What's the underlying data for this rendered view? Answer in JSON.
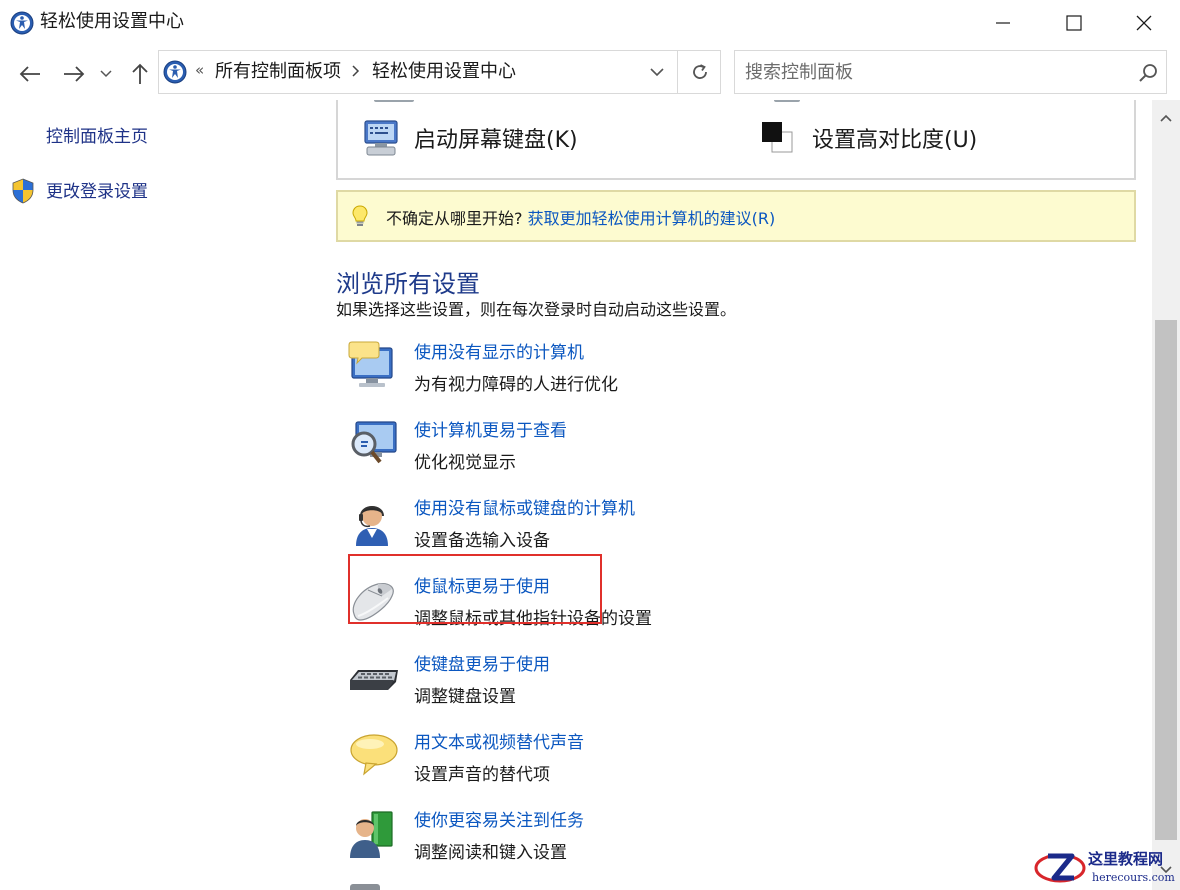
{
  "window": {
    "title": "轻松使用设置中心"
  },
  "address": {
    "overflow": "«",
    "crumbs": [
      "所有控制面板项",
      "轻松使用设置中心"
    ]
  },
  "search": {
    "placeholder": "搜索控制面板"
  },
  "sidebar": {
    "links": [
      "控制面板主页",
      "更改登录设置"
    ]
  },
  "quick_access": {
    "items": [
      "启动屏幕键盘(K)",
      "设置高对比度(U)"
    ]
  },
  "tip": {
    "prefix": "不确定从哪里开始?",
    "link": "获取更加轻松使用计算机的建议(R)"
  },
  "browse": {
    "title": "浏览所有设置",
    "subtitle": "如果选择这些设置，则在每次登录时自动启动这些设置。",
    "items": [
      {
        "title": "使用没有显示的计算机",
        "desc": "为有视力障碍的人进行优化",
        "icon": "monitor-speech-icon"
      },
      {
        "title": "使计算机更易于查看",
        "desc": "优化视觉显示",
        "icon": "magnifier-monitor-icon"
      },
      {
        "title": "使用没有鼠标或键盘的计算机",
        "desc": "设置备选输入设备",
        "icon": "headset-user-icon"
      },
      {
        "title": "使鼠标更易于使用",
        "desc": "调整鼠标或其他指针设备的设置",
        "icon": "mouse-icon"
      },
      {
        "title": "使键盘更易于使用",
        "desc": "调整键盘设置",
        "icon": "keyboard-icon"
      },
      {
        "title": "用文本或视频替代声音",
        "desc": "设置声音的替代项",
        "icon": "speech-bubble-icon"
      },
      {
        "title": "使你更容易关注到任务",
        "desc": "调整阅读和键入设置",
        "icon": "user-book-icon"
      }
    ]
  },
  "watermark": {
    "name": "这里教程网",
    "url": "herecours.com"
  },
  "colors": {
    "link": "#0b57c0",
    "heading": "#1e3a8a",
    "highlight": "#e0302b",
    "tip_bg": "#fdfbd0"
  }
}
